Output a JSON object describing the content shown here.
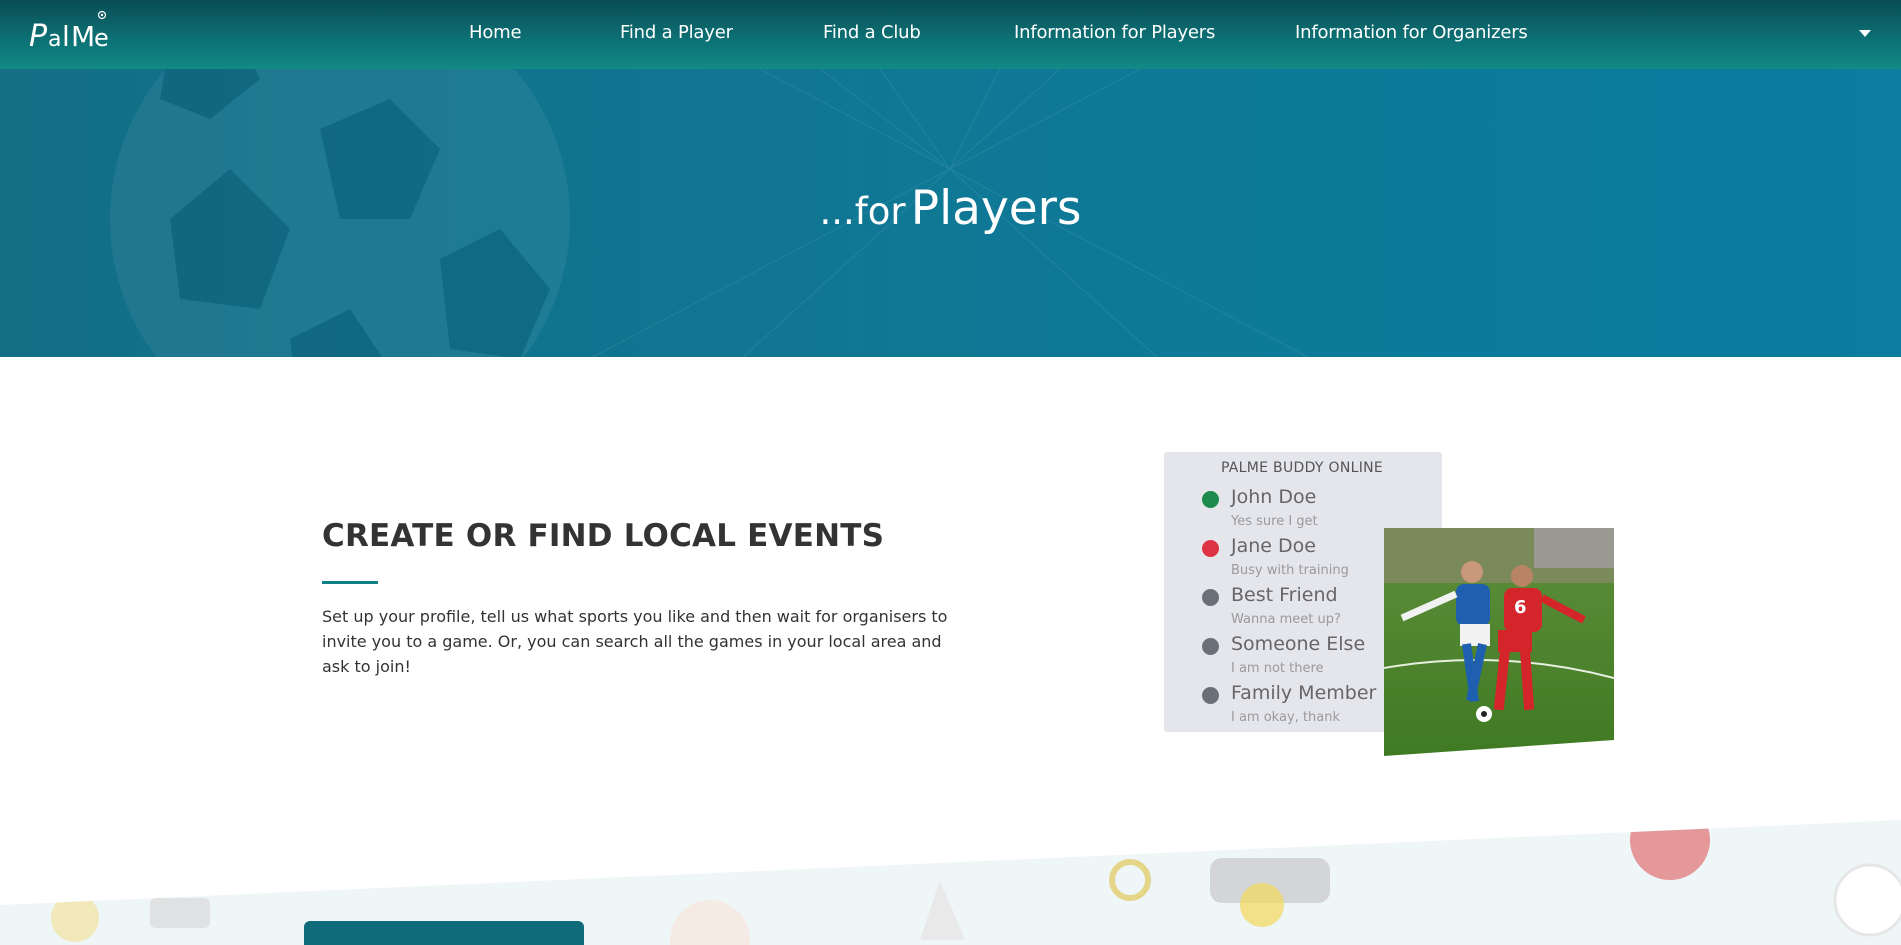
{
  "brand": {
    "logo_text": "PalMe"
  },
  "nav": {
    "items": [
      {
        "label": "Home"
      },
      {
        "label": "Find a Player"
      },
      {
        "label": "Find a Club"
      },
      {
        "label": "Information for Players"
      },
      {
        "label": "Information for Organizers"
      }
    ],
    "dropdown_icon": "caret-down-icon"
  },
  "hero": {
    "prefix": "...for",
    "title": "Players"
  },
  "section": {
    "title": "CREATE OR FIND LOCAL EVENTS",
    "description": "Set up your profile, tell us what sports you like and then wait for organisers to invite you to a game. Or, you can search all the games in your local area and ask to join!"
  },
  "buddy_widget": {
    "title": "PALME BUDDY ONLINE",
    "buddies": [
      {
        "name": "John Doe",
        "status": "Yes sure I get",
        "color": "#1e8a4c"
      },
      {
        "name": "Jane Doe",
        "status": "Busy with training",
        "color": "#dd3344"
      },
      {
        "name": "Best Friend",
        "status": "Wanna meet up?",
        "color": "#6b6f78"
      },
      {
        "name": "Someone Else",
        "status": "I am not there",
        "color": "#6b6f78"
      },
      {
        "name": "Family Member",
        "status": "I am okay, thank",
        "color": "#6b6f78"
      }
    ]
  },
  "colors": {
    "nav_accent": "#0c6f73",
    "hero_bg": "#0f7895",
    "accent_line": "#0f7f86"
  }
}
